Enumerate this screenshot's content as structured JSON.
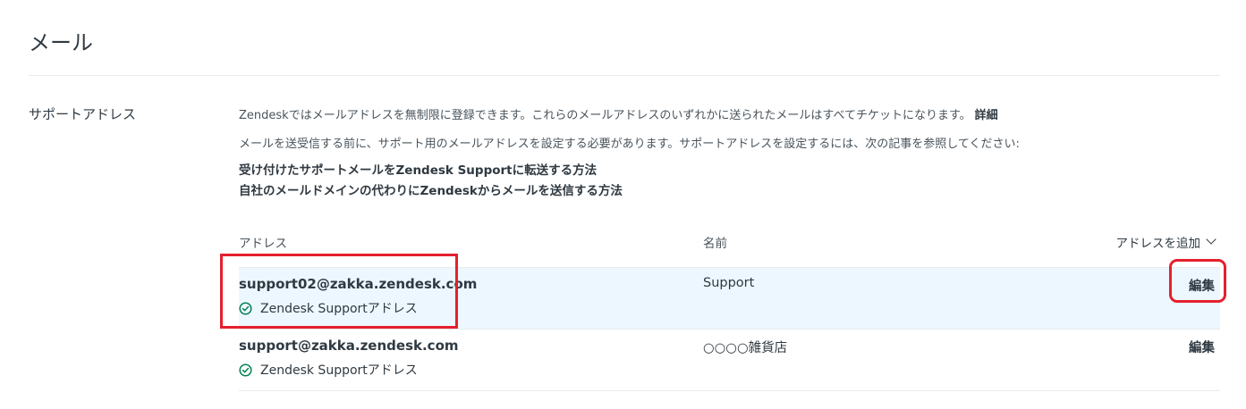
{
  "page": {
    "title": "メール"
  },
  "section": {
    "label": "サポートアドレス"
  },
  "description": {
    "line1": "Zendeskではメールアドレスを無制限に登録できます。これらのメールアドレスのいずれかに送られたメールはすべてチケットになります。",
    "details_link": "詳細",
    "line2": "メールを送受信する前に、サポート用のメールアドレスを設定する必要があります。サポートアドレスを設定するには、次の記事を参照してください:"
  },
  "articles": [
    {
      "label": "受け付けたサポートメールをZendesk Supportに転送する方法"
    },
    {
      "label": "自社のメールドメインの代わりにZendeskからメールを送信する方法"
    }
  ],
  "table": {
    "headers": {
      "address": "アドレス",
      "name": "名前"
    },
    "add_address_label": "アドレスを追加",
    "rows": [
      {
        "email": "support02@zakka.zendesk.com",
        "badge": "Zendesk Supportアドレス",
        "name": "Support",
        "edit_label": "編集",
        "highlighted": true
      },
      {
        "email": "support@zakka.zendesk.com",
        "badge": "Zendesk Supportアドレス",
        "name": "○○○○雑貨店",
        "edit_label": "編集",
        "highlighted": false
      }
    ]
  },
  "colors": {
    "accent_check": "#038153",
    "annotation_red": "#e5202e",
    "row_highlight": "#edf7ff"
  },
  "icons": {
    "badge": "check-circle-icon",
    "dropdown": "chevron-down-icon"
  }
}
